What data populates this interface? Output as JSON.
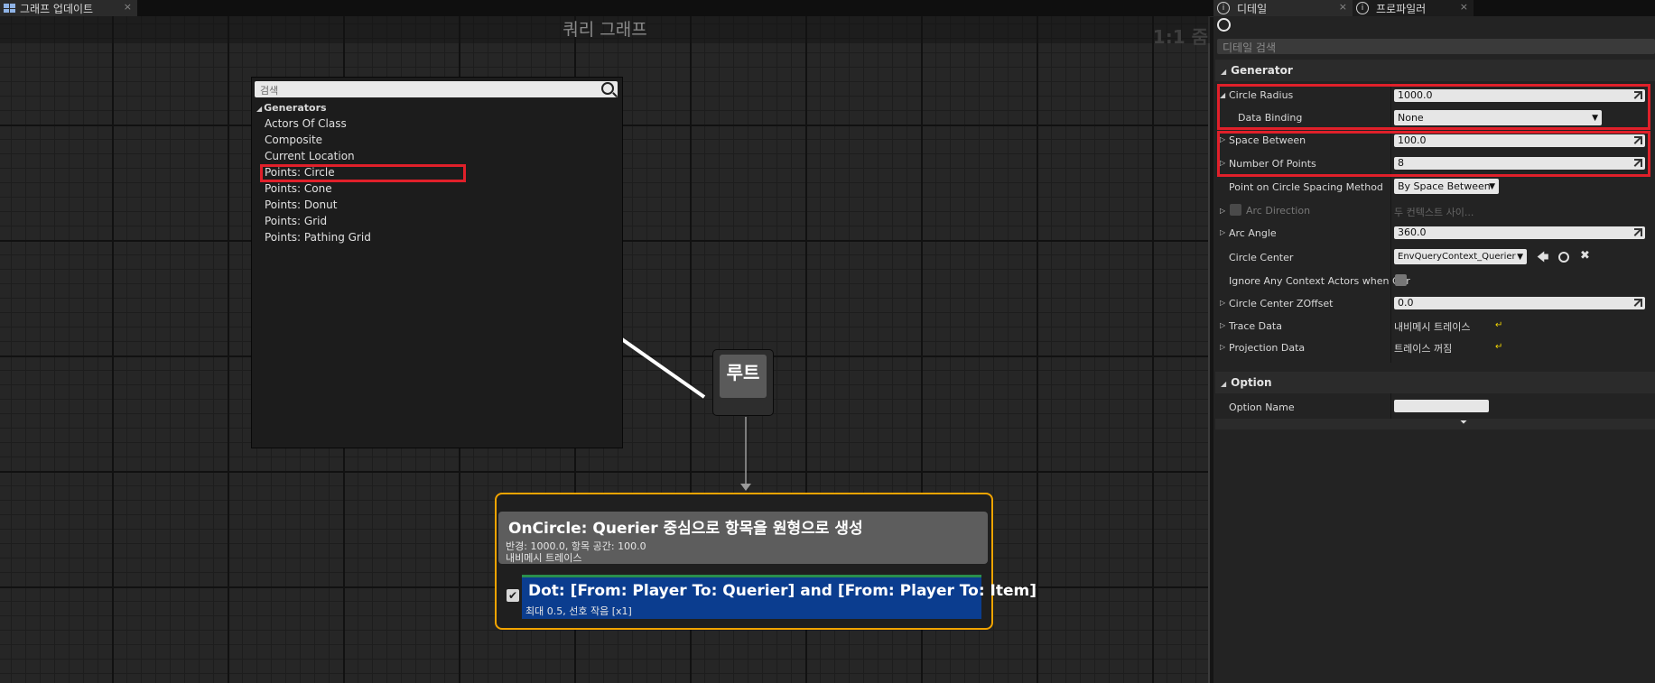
{
  "tabs": {
    "graph_tab": "그래프 업데이트",
    "details_tab": "디테일",
    "profiler_tab": "프로파일러",
    "close": "×",
    "info_glyph": "i"
  },
  "graph": {
    "title": "쿼리 그래프",
    "zoom": "1:1 줌",
    "popup": {
      "search_placeholder": "검색",
      "group": "Generators",
      "items": [
        "Actors Of Class",
        "Composite",
        "Current Location",
        "Points: Circle",
        "Points: Cone",
        "Points: Donut",
        "Points: Grid",
        "Points: Pathing Grid"
      ]
    },
    "root_node": "루트",
    "generator": {
      "title": "OnCircle: Querier 중심으로 항목을 원형으로 생성",
      "line1": "반경: 1000.0, 항목 공간: 100.0",
      "line2": "내비메시 트레이스",
      "checkbox": "✔",
      "test_title": "Dot: [From: Player To: Querier] and [From: Player To: Item]",
      "test_sub": "최대 0.5, 선호 작음 [x1]"
    }
  },
  "details": {
    "search_placeholder": "디테일 검색",
    "generator_category": "Generator",
    "option_category": "Option",
    "props": {
      "circle_radius": {
        "label": "Circle Radius",
        "value": "1000.0"
      },
      "data_binding": {
        "label": "Data Binding",
        "value": "None"
      },
      "space_between": {
        "label": "Space Between",
        "value": "100.0"
      },
      "number_of_points": {
        "label": "Number Of Points",
        "value": "8"
      },
      "spacing_method": {
        "label": "Point on Circle Spacing Method",
        "value": "By Space Between"
      },
      "arc_direction": {
        "label": "Arc Direction",
        "value": "두 컨텍스트 사이..."
      },
      "arc_angle": {
        "label": "Arc Angle",
        "value": "360.0"
      },
      "circle_center": {
        "label": "Circle Center",
        "value": "EnvQueryContext_Querier"
      },
      "ignore_context": {
        "label": "Ignore Any Context Actors when Ger"
      },
      "circle_center_zoffset": {
        "label": "Circle Center ZOffset",
        "value": "0.0"
      },
      "trace_data": {
        "label": "Trace Data",
        "value": "내비메시 트레이스"
      },
      "projection_data": {
        "label": "Projection Data",
        "value": "트레이스 꺼짐"
      },
      "option_name": {
        "label": "Option Name",
        "value": ""
      }
    }
  }
}
